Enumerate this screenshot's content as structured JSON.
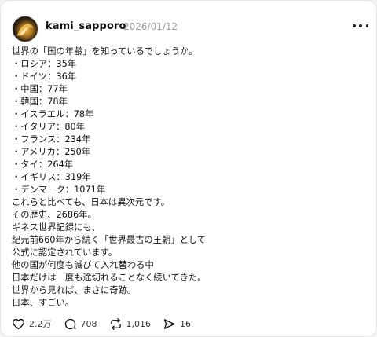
{
  "post": {
    "username": "kami_sapporo",
    "date": "2026/01/12",
    "lines": [
      "世界の「国の年齢」を知っているでしょうか。",
      "・ロシア：35年",
      "・ドイツ：36年",
      "・中国：77年",
      "・韓国：78年",
      "・イスラエル：78年",
      "・イタリア：80年",
      "・フランス：234年",
      "・アメリカ：250年",
      "・タイ：264年",
      "・イギリス：319年",
      "・デンマーク：1071年",
      "これらと比べても、日本は異次元です。",
      "その歴史、2686年。",
      "ギネス世界記録にも、",
      "紀元前660年から続く「世界最古の王朝」として",
      "公式に認定されています。",
      "他の国が何度も滅びて入れ替わる中",
      "日本だけは一度も途切れることなく続いてきた。",
      "世界から見れば、まさに奇跡。",
      "日本、すごい。"
    ]
  },
  "actions": {
    "likes": "2.2万",
    "replies": "708",
    "reposts": "1,016",
    "shares": "16"
  },
  "icons": {
    "avatar": "avatar-image",
    "more": "more-options-icon",
    "like": "heart-icon",
    "reply": "comment-icon",
    "repost": "repost-icon",
    "share": "send-icon"
  }
}
